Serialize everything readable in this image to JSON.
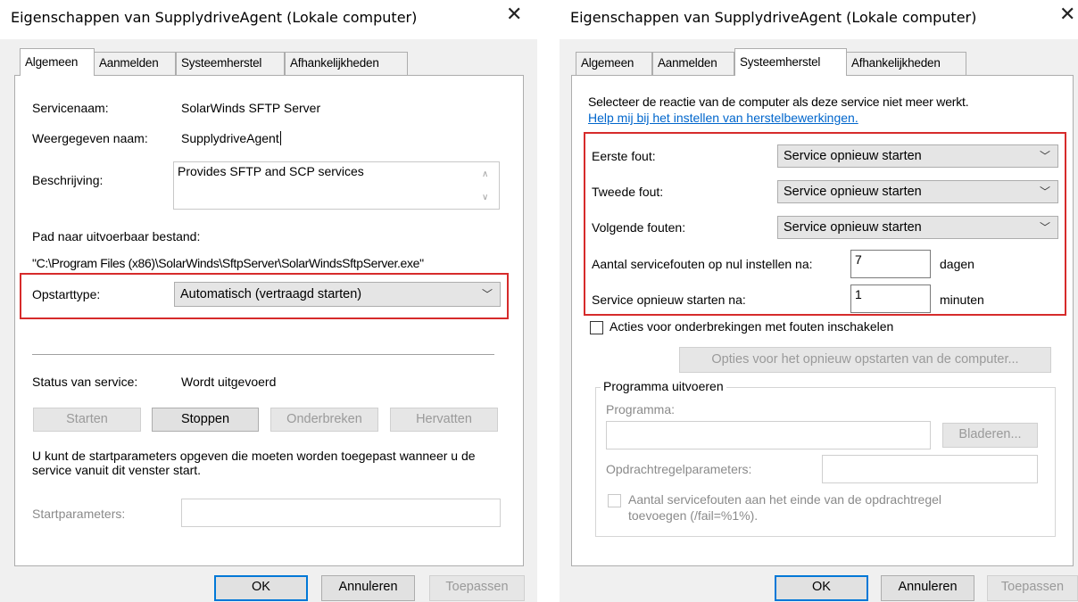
{
  "left": {
    "title": "Eigenschappen van SupplydriveAgent (Lokale computer)",
    "close_glyph": "✕",
    "tabs": [
      "Algemeen",
      "Aanmelden",
      "Systeemherstel",
      "Afhankelijkheden"
    ],
    "active_tab": "Algemeen",
    "service_name_label": "Servicenaam:",
    "service_name_value": "SolarWinds SFTP Server",
    "display_name_label": "Weergegeven naam:",
    "display_name_value": "SupplydriveAgent",
    "description_label": "Beschrijving:",
    "description_value": "Provides SFTP and SCP services",
    "path_label": "Pad naar uitvoerbaar bestand:",
    "path_value": "\"C:\\Program Files (x86)\\SolarWinds\\SftpServer\\SolarWindsSftpServer.exe\"",
    "startup_type_label": "Opstarttype:",
    "startup_type_value": "Automatisch (vertraagd starten)",
    "status_label": "Status van service:",
    "status_value": "Wordt uitgevoerd",
    "btn_start": "Starten",
    "btn_stop": "Stoppen",
    "btn_pause": "Onderbreken",
    "btn_resume": "Hervatten",
    "startparams_help": "U kunt de startparameters opgeven die moeten worden toegepast wanneer u de service vanuit dit venster start.",
    "startparams_label": "Startparameters:",
    "startparams_value": "",
    "btn_ok": "OK",
    "btn_cancel": "Annuleren",
    "btn_apply": "Toepassen"
  },
  "right": {
    "title": "Eigenschappen van SupplydriveAgent (Lokale computer)",
    "close_glyph": "✕",
    "tabs": [
      "Algemeen",
      "Aanmelden",
      "Systeemherstel",
      "Afhankelijkheden"
    ],
    "active_tab": "Systeemherstel",
    "intro": "Selecteer de reactie van de computer als deze service niet meer werkt.",
    "help_link": "Help mij bij het instellen van herstelbewerkingen.",
    "first_failure_label": "Eerste fout:",
    "first_failure_value": "Service opnieuw starten",
    "second_failure_label": "Tweede fout:",
    "second_failure_value": "Service opnieuw starten",
    "subsequent_failures_label": "Volgende fouten:",
    "subsequent_failures_value": "Service opnieuw starten",
    "reset_count_label": "Aantal servicefouten op nul instellen na:",
    "reset_count_value": "7",
    "reset_count_unit": "dagen",
    "restart_after_label": "Service opnieuw starten na:",
    "restart_after_value": "1",
    "restart_after_unit": "minuten",
    "enable_actions_label": "Acties voor onderbrekingen met fouten inschakelen",
    "enable_actions_checked": false,
    "restart_options_btn": "Opties voor het opnieuw opstarten van de computer...",
    "run_program_group": "Programma uitvoeren",
    "program_label": "Programma:",
    "program_value": "",
    "browse_btn": "Bladeren...",
    "cmdline_label": "Opdrachtregelparameters:",
    "cmdline_value": "",
    "append_fail_label": "Aantal servicefouten aan het einde van de opdrachtregel",
    "append_fail_label_2": "toevoegen (/fail=%1%).",
    "btn_ok": "OK",
    "btn_cancel": "Annuleren",
    "btn_apply": "Toepassen"
  },
  "colors": {
    "highlight_border": "#d62b2b",
    "link": "#0066cc",
    "focus_blue": "#0078d7"
  }
}
